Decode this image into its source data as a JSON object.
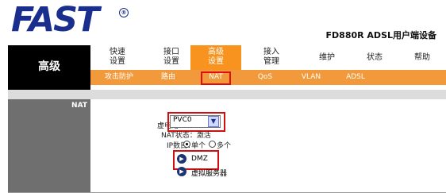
{
  "header": {
    "logo": "FAST",
    "logo_mark": "®",
    "device": "FD880R ADSL用户端设备"
  },
  "left": {
    "title": "高级",
    "section": "NAT"
  },
  "nav": [
    {
      "line1": "快速",
      "line2": "设置"
    },
    {
      "line1": "接口",
      "line2": "设置"
    },
    {
      "line1": "高级",
      "line2": "设置"
    },
    {
      "line1": "接入",
      "line2": "管理"
    },
    {
      "label": "维护"
    },
    {
      "label": "状态"
    },
    {
      "label": "帮助"
    }
  ],
  "subnav": [
    "攻击防护",
    "路由",
    "NAT",
    "QoS",
    "VLAN",
    "ADSL"
  ],
  "form": {
    "vc_label": "虚电路：",
    "vc_value": "PVC0",
    "nat_status": "NAT状态：激活",
    "ip_label": "IP数目：",
    "radio_single": "单个",
    "radio_multi": "多个",
    "dmz": "DMZ",
    "virtual_server": "虚拟服务器"
  },
  "colors": {
    "accent_orange": "#f7931e",
    "logo_blue": "#1a2e8e",
    "highlight_red": "#d01010"
  }
}
